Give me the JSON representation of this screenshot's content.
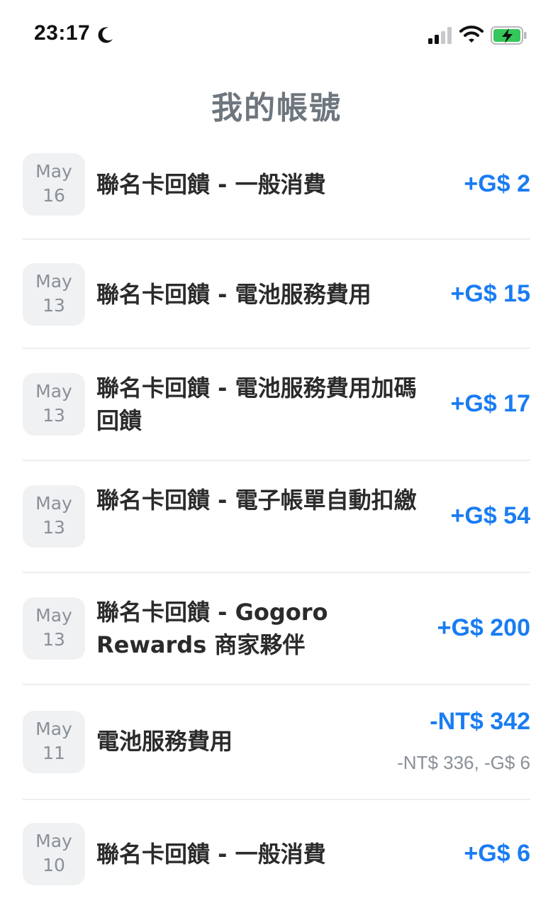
{
  "status_bar": {
    "time": "23:17",
    "moon_icon": "moon-icon",
    "signal_icon": "cellular-signal-icon",
    "wifi_icon": "wifi-icon",
    "battery_icon": "battery-charging-icon",
    "battery_color": "#34c759"
  },
  "header": {
    "title": "我的帳號"
  },
  "colors": {
    "accent": "#1a7cf2",
    "title_gray": "#6e767e",
    "badge_bg": "#eff1f3",
    "divider": "#eceef0"
  },
  "transactions": [
    {
      "month": "May",
      "day": "16",
      "description": "聯名卡回饋 - 一般消費",
      "amount": "+G$ 2"
    },
    {
      "month": "May",
      "day": "13",
      "description": "聯名卡回饋 - 電池服務費用",
      "amount": "+G$ 15"
    },
    {
      "month": "May",
      "day": "13",
      "description": "聯名卡回饋 - 電池服務費用加碼回饋",
      "amount": "+G$ 17"
    },
    {
      "month": "May",
      "day": "13",
      "description": "聯名卡回饋 - 電子帳單自動扣繳",
      "amount": "+G$ 54"
    },
    {
      "month": "May",
      "day": "13",
      "description": "聯名卡回饋 - Gogoro Rewards 商家夥伴",
      "amount": "+G$ 200"
    },
    {
      "month": "May",
      "day": "11",
      "description": "電池服務費用",
      "amount": "-NT$ 342",
      "sub_amount": "-NT$ 336, -G$ 6"
    },
    {
      "month": "May",
      "day": "10",
      "description": "聯名卡回饋 - 一般消費",
      "amount": "+G$ 6"
    }
  ]
}
